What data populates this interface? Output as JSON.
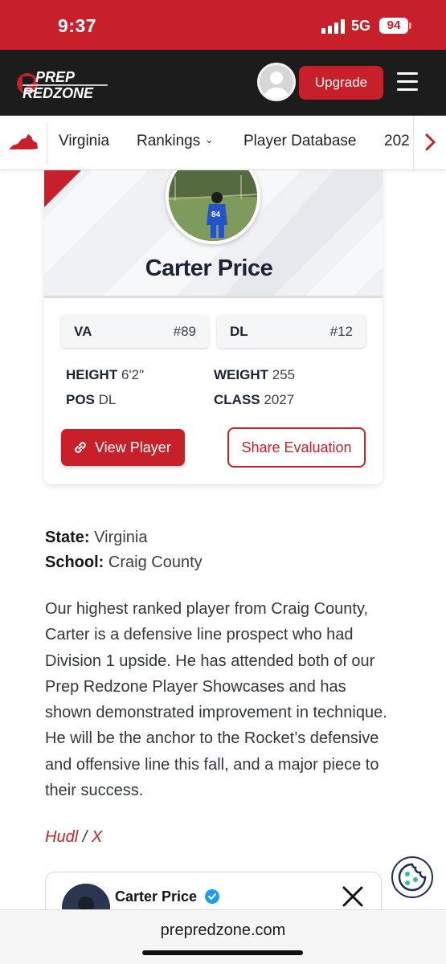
{
  "status_bar": {
    "time": "9:37",
    "network": "5G",
    "battery": "94"
  },
  "header": {
    "logo_line1": "PREP",
    "logo_line2": "REDZONE",
    "upgrade_label": "Upgrade"
  },
  "nav": {
    "items": [
      "Virginia",
      "Rankings",
      "Player Database",
      "202"
    ],
    "state_icon": "virginia-state-icon",
    "next_icon": "chevron-right-icon"
  },
  "player_card": {
    "name": "Carter Price",
    "state_rank_label": "VA",
    "state_rank_value": "#89",
    "position_rank_label": "DL",
    "position_rank_value": "#12",
    "height_label": "HEIGHT",
    "height_value": "6'2\"",
    "weight_label": "WEIGHT",
    "weight_value": "255",
    "pos_label": "POS",
    "pos_value": "DL",
    "class_label": "CLASS",
    "class_value": "2027",
    "view_button": "View Player",
    "share_button": "Share Evaluation",
    "photo_jersey": "84"
  },
  "details": {
    "state_label": "State:",
    "state_value": "Virginia",
    "school_label": "School:",
    "school_value": "Craig County",
    "description": "Our highest ranked player from Craig County, Carter is a defensive line prospect who had Division 1 upside. He has attended both of our Prep Redzone Player Showcases and has shown demonstrated improvement in technique. He will be the anchor to the Rocket’s defensive and offensive line this fall, and a major piece to their success.",
    "link_hudl": "Hudl",
    "link_separator": "/",
    "link_x": "X"
  },
  "tweet": {
    "name": "Carter Price"
  },
  "browser": {
    "url": "prepredzone.com"
  },
  "colors": {
    "brand_red": "#c8202a",
    "header_dark": "#1c1c1c",
    "card_bg": "#eef0f3"
  }
}
